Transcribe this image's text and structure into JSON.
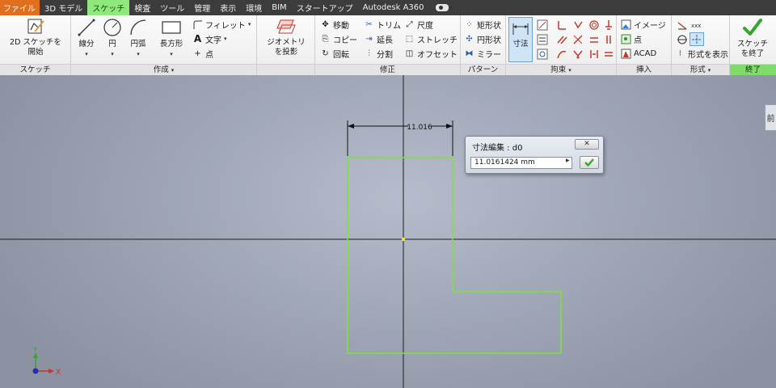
{
  "tabs": [
    {
      "label": "ファイル",
      "style": "file"
    },
    {
      "label": "3D モデル"
    },
    {
      "label": "スケッチ",
      "style": "active"
    },
    {
      "label": "検査"
    },
    {
      "label": "ツール"
    },
    {
      "label": "管理"
    },
    {
      "label": "表示"
    },
    {
      "label": "環境"
    },
    {
      "label": "BIM"
    },
    {
      "label": "スタートアップ"
    },
    {
      "label": "Autodesk A360"
    }
  ],
  "ribbon": {
    "sketch": {
      "title": "スケッチ",
      "start_label_1": "2D スケッチを",
      "start_label_2": "開始"
    },
    "create": {
      "title": "作成",
      "line": "線分",
      "circle": "円",
      "arc": "円弧",
      "rect": "長方形",
      "fillet": "フィレット",
      "text": "文字",
      "point": "点"
    },
    "project": {
      "label_1": "ジオメトリ",
      "label_2": "を投影"
    },
    "modify": {
      "title": "修正",
      "move": "移動",
      "trim": "トリム",
      "scale": "尺度",
      "copy": "コピー",
      "extend": "延長",
      "stretch": "ストレッチ",
      "rotate": "回転",
      "split": "分割",
      "offset": "オフセット"
    },
    "pattern": {
      "title": "パターン",
      "rect": "矩形状",
      "circ": "円形状",
      "mirror": "ミラー"
    },
    "constrain": {
      "title": "拘束",
      "dimension": "寸法"
    },
    "insert": {
      "title": "挿入",
      "image": "イメージ",
      "point": "点",
      "acad": "ACAD"
    },
    "format": {
      "title": "形式",
      "show": "形式を表示"
    },
    "exit": {
      "title": "終了",
      "finish_1": "スケッチ",
      "finish_2": "を終了"
    }
  },
  "canvas": {
    "dimension_text": "11.016",
    "dialog": {
      "title": "寸法編集 : d0",
      "value": "11.0161424 mm"
    },
    "right_tab": "前",
    "axis_x": "X",
    "axis_y": "Y"
  },
  "colors": {
    "sketch_line": "#7ee23a",
    "axis_line": "#1e1e1e",
    "file_tab": "#e0701f",
    "active_tab": "#8ee87c",
    "confirm_check": "#3aa332"
  }
}
